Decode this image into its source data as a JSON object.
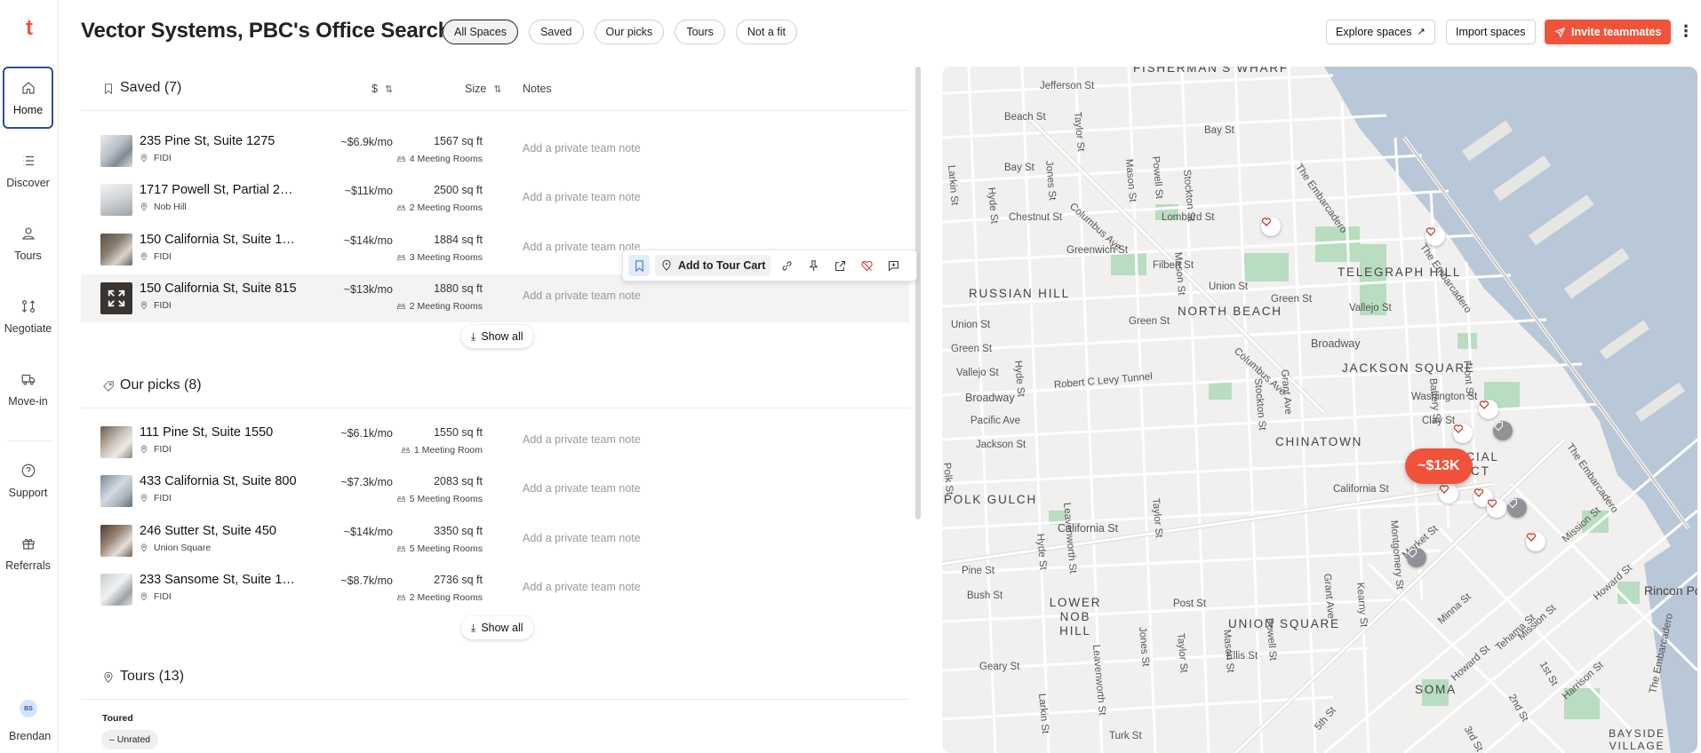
{
  "nav": {
    "logo": "t",
    "items": [
      {
        "label": "Home",
        "icon": "home-icon"
      },
      {
        "label": "Discover",
        "icon": "list-icon"
      },
      {
        "label": "Tours",
        "icon": "person-icon"
      },
      {
        "label": "Negotiate",
        "icon": "negotiate-icon"
      },
      {
        "label": "Move-in",
        "icon": "truck-icon"
      },
      {
        "label": "Support",
        "icon": "help-icon"
      },
      {
        "label": "Referrals",
        "icon": "gift-icon"
      }
    ],
    "user_initials": "BS",
    "user_name": "Brendan"
  },
  "header": {
    "title": "Vector Systems, PBC's Office Search",
    "tabs": [
      "All Spaces",
      "Saved",
      "Our picks",
      "Tours",
      "Not a fit"
    ],
    "active_tab": "All Spaces",
    "explore_label": "Explore spaces",
    "import_label": "Import spaces",
    "invite_label": "Invite teammates",
    "accent_color": "#f0533a"
  },
  "columns": {
    "price": "$",
    "size": "Size",
    "notes": "Notes"
  },
  "saved": {
    "title": "Saved (7)",
    "show_all": "Show all",
    "rows": [
      {
        "address": "235 Pine St, Suite 1275",
        "neighborhood": "FIDI",
        "price": "~$6.9k/mo",
        "size": "1567 sq ft",
        "rooms": "4 Meeting Rooms",
        "note": "Add a private team note"
      },
      {
        "address": "1717 Powell St, Partial 2nd ...",
        "neighborhood": "Nob Hill",
        "price": "~$11k/mo",
        "size": "2500 sq ft",
        "rooms": "2 Meeting Rooms",
        "note": "Add a private team note"
      },
      {
        "address": "150 California St, Suite 1050",
        "neighborhood": "FIDI",
        "price": "~$14k/mo",
        "size": "1884 sq ft",
        "rooms": "3 Meeting Rooms",
        "note": "Add a private team note"
      },
      {
        "address": "150 California St, Suite 815",
        "neighborhood": "FIDI",
        "price": "~$13k/mo",
        "size": "1880 sq ft",
        "rooms": "2 Meeting Rooms",
        "note": "Add a private team note"
      }
    ]
  },
  "row_toolbar": {
    "add_to_cart": "Add to Tour Cart"
  },
  "picks": {
    "title": "Our picks (8)",
    "show_all": "Show all",
    "rows": [
      {
        "address": "111 Pine St, Suite 1550",
        "neighborhood": "FIDI",
        "price": "~$6.1k/mo",
        "size": "1550 sq ft",
        "rooms": "1 Meeting Room",
        "note": "Add a private team note"
      },
      {
        "address": "433 California St, Suite 800",
        "neighborhood": "FIDI",
        "price": "~$7.3k/mo",
        "size": "2083 sq ft",
        "rooms": "5 Meeting Rooms",
        "note": "Add a private team note"
      },
      {
        "address": "246 Sutter St, Suite 450",
        "neighborhood": "Union Square",
        "price": "~$14k/mo",
        "size": "3350 sq ft",
        "rooms": "5 Meeting Rooms",
        "note": "Add a private team note"
      },
      {
        "address": "233 Sansome St, Suite 1008",
        "neighborhood": "FIDI",
        "price": "~$8.7k/mo",
        "size": "2736 sq ft",
        "rooms": "2 Meeting Rooms",
        "note": "Add a private team note"
      }
    ]
  },
  "tours": {
    "title": "Tours (13)",
    "toured_label": "Toured",
    "rating": "Unrated"
  },
  "map": {
    "price_pin": "~$13K",
    "neighborhoods": [
      "FISHERMAN'S WHARF",
      "TELEGRAPH HILL",
      "RUSSIAN HILL",
      "NORTH BEACH",
      "JACKSON SQUARE",
      "CHINATOWN",
      "FINANCIAL DISTRICT",
      "POLK GULCH",
      "LOWER NOB HILL",
      "UNION SQUARE",
      "SOMA",
      "BAYSIDE VILLAGE",
      "Rincon Point"
    ],
    "streets": [
      "Jefferson St",
      "Beach St",
      "Bay St",
      "Chestnut St",
      "Lombard St",
      "Greenwich St",
      "Filbert St",
      "Union St",
      "Green St",
      "Vallejo St",
      "Broadway",
      "Pacific Ave",
      "Jackson St",
      "Washington St",
      "Clay St",
      "California St",
      "Pine St",
      "Bush St",
      "Post St",
      "Geary St",
      "Ellis St",
      "Turk St",
      "Market St",
      "Mission St",
      "Howard St",
      "Columbus Ave",
      "The Embarcadero",
      "Robert C Levy Tunnel",
      "Larkin St",
      "Hyde St",
      "Leavenworth St",
      "Jones St",
      "Taylor St",
      "Mason St",
      "Powell St",
      "Stockton St",
      "Grant Ave",
      "Kearny St",
      "Montgomery St",
      "Battery St",
      "Front St",
      "1st St",
      "2nd St",
      "3rd St",
      "5th St",
      "Tehama St",
      "Minna St",
      "Harrison St",
      "Polk St"
    ]
  }
}
